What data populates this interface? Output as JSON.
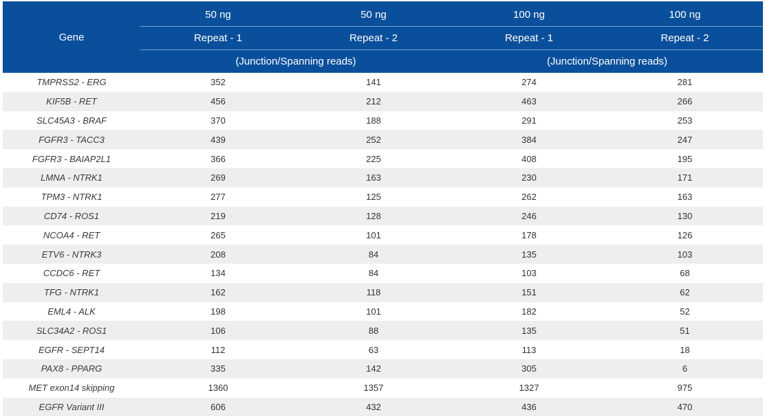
{
  "header": {
    "gene_label": "Gene",
    "amounts": [
      "50 ng",
      "50 ng",
      "100 ng",
      "100 ng"
    ],
    "repeats": [
      "Repeat - 1",
      "Repeat - 2",
      "Repeat - 1",
      "Repeat - 2"
    ],
    "units": [
      "(Junction/Spanning reads)",
      "(Junction/Spanning reads)"
    ]
  },
  "rows": [
    {
      "gene": "TMPRSS2 - ERG",
      "v": [
        "352",
        "141",
        "274",
        "281"
      ]
    },
    {
      "gene": "KIF5B - RET",
      "v": [
        "456",
        "212",
        "463",
        "266"
      ]
    },
    {
      "gene": "SLC45A3 - BRAF",
      "v": [
        "370",
        "188",
        "291",
        "253"
      ]
    },
    {
      "gene": "FGFR3 - TACC3",
      "v": [
        "439",
        "252",
        "384",
        "247"
      ]
    },
    {
      "gene": "FGFR3 - BAIAP2L1",
      "v": [
        "366",
        "225",
        "408",
        "195"
      ]
    },
    {
      "gene": "LMNA - NTRK1",
      "v": [
        "269",
        "163",
        "230",
        "171"
      ]
    },
    {
      "gene": "TPM3 - NTRK1",
      "v": [
        "277",
        "125",
        "262",
        "163"
      ]
    },
    {
      "gene": "CD74 - ROS1",
      "v": [
        "219",
        "128",
        "246",
        "130"
      ]
    },
    {
      "gene": "NCOA4 - RET",
      "v": [
        "265",
        "101",
        "178",
        "126"
      ]
    },
    {
      "gene": "ETV6 - NTRK3",
      "v": [
        "208",
        "84",
        "135",
        "103"
      ]
    },
    {
      "gene": "CCDC6 - RET",
      "v": [
        "134",
        "84",
        "103",
        "68"
      ]
    },
    {
      "gene": "TFG - NTRK1",
      "v": [
        "162",
        "118",
        "151",
        "62"
      ]
    },
    {
      "gene": "EML4 - ALK",
      "v": [
        "198",
        "101",
        "182",
        "52"
      ]
    },
    {
      "gene": "SLC34A2 - ROS1",
      "v": [
        "106",
        "88",
        "135",
        "51"
      ]
    },
    {
      "gene": "EGFR - SEPT14",
      "v": [
        "112",
        "63",
        "113",
        "18"
      ]
    },
    {
      "gene": "PAX8 - PPARG",
      "v": [
        "335",
        "142",
        "305",
        "6"
      ]
    },
    {
      "gene": "MET exon14 skipping",
      "v": [
        "1360",
        "1357",
        "1327",
        "975"
      ]
    },
    {
      "gene": "EGFR Variant III",
      "v": [
        "606",
        "432",
        "436",
        "470"
      ]
    }
  ]
}
